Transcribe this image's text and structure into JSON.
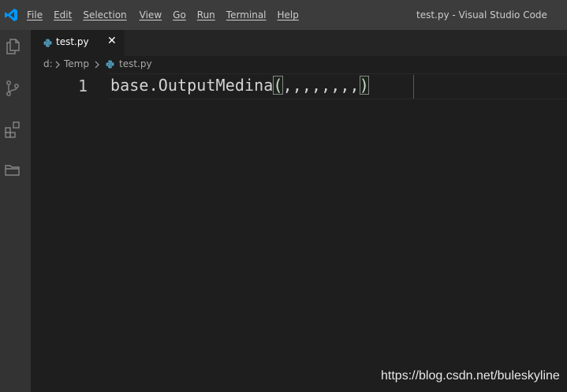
{
  "titlebar": {
    "menu": [
      "File",
      "Edit",
      "Selection",
      "View",
      "Go",
      "Run",
      "Terminal",
      "Help"
    ],
    "window_title": "test.py - Visual Studio Code"
  },
  "tabs": [
    {
      "label": "test.py",
      "close": "✕"
    }
  ],
  "breadcrumb": {
    "items": [
      "d:",
      "Temp",
      "test.py"
    ]
  },
  "editor": {
    "line_number": "1",
    "code_prefix": "base.OutputMedina",
    "code_open": "(",
    "code_args": ",,,,,,,,",
    "code_close": ")"
  },
  "watermark": "https://blog.csdn.net/buleskyline",
  "colors": {
    "titlebar_bg": "#3c3c3c",
    "activitybar_bg": "#333333",
    "editor_bg": "#1e1e1e",
    "vscode_blue": "#0098ff",
    "python_blue": "#519aba"
  },
  "icons": {
    "activity": [
      "explorer-icon",
      "source-control-icon",
      "extensions-icon",
      "remote-explorer-icon"
    ]
  }
}
